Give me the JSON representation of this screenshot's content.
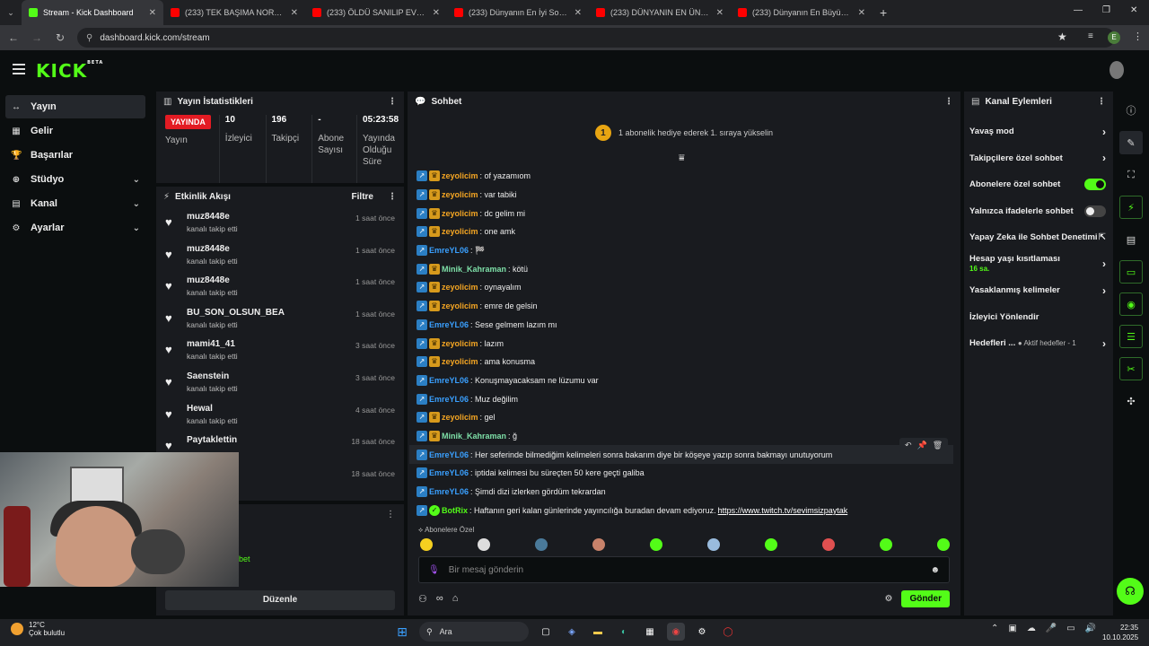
{
  "browser": {
    "tabs": [
      {
        "title": "Stream - Kick Dashboard",
        "fav": "#53fc18",
        "active": true
      },
      {
        "title": "(233) TEK BAŞIMA NORVEÇ KÖ",
        "fav": "#ff0000"
      },
      {
        "title": "(233) ÖLDÜ SANILIP EVEREST'I",
        "fav": "#ff0000"
      },
      {
        "title": "(233) Dünyanın En İyi Sokak Ye",
        "fav": "#ff0000"
      },
      {
        "title": "(233) DÜNYANIN EN ÜNLÜ HA",
        "fav": "#ff0000"
      },
      {
        "title": "(233) Dünyanın En Büyük Mağa",
        "fav": "#ff0000"
      }
    ],
    "url": "dashboard.kick.com/stream",
    "profile_letter": "E"
  },
  "kick": {
    "logo": "KICK",
    "beta": "BETA"
  },
  "sidebar": [
    {
      "icon": "↔",
      "label": "Yayın",
      "active": true
    },
    {
      "icon": "▦",
      "label": "Gelir"
    },
    {
      "icon": "🏆",
      "label": "Başarılar"
    },
    {
      "icon": "⊕",
      "label": "Stüdyo",
      "chev": true
    },
    {
      "icon": "▤",
      "label": "Kanal",
      "chev": true
    },
    {
      "icon": "⚙",
      "label": "Ayarlar",
      "chev": true
    }
  ],
  "stats": {
    "title": "Yayın İstatistikleri",
    "live": "YAYINDA",
    "live_label": "Yayın",
    "items": [
      {
        "value": "10",
        "label": "İzleyici"
      },
      {
        "value": "196",
        "label": "Takipçi"
      },
      {
        "value": "-",
        "label": "Abone Sayısı"
      },
      {
        "value": "05:23:58",
        "label": "Yayında Olduğu Süre"
      }
    ]
  },
  "activity": {
    "title": "Etkinlik Akışı",
    "filter": "Filtre",
    "items": [
      {
        "user": "muz8448e",
        "sub": "kanalı takip etti",
        "time": "1 saat önce"
      },
      {
        "user": "muz8448e",
        "sub": "kanalı takip etti",
        "time": "1 saat önce"
      },
      {
        "user": "muz8448e",
        "sub": "kanalı takip etti",
        "time": "1 saat önce"
      },
      {
        "user": "BU_SON_OLSUN_BEA",
        "sub": "kanalı takip etti",
        "time": "1 saat önce"
      },
      {
        "user": "mami41_41",
        "sub": "kanalı takip etti",
        "time": "3 saat önce"
      },
      {
        "user": "Saenstein",
        "sub": "kanalı takip etti",
        "time": "3 saat önce"
      },
      {
        "user": "Hewal",
        "sub": "kanalı takip etti",
        "time": "4 saat önce"
      },
      {
        "user": "Paytaklettin",
        "sub": "",
        "time": "18 saat önce"
      },
      {
        "user": "",
        "sub": "",
        "time": "18 saat önce"
      }
    ]
  },
  "bottom_left": {
    "edit": "Düzenle",
    "partial": "bet"
  },
  "chat": {
    "title": "Sohbet",
    "gift_rank": "1",
    "gift_text": "1 abonelik hediye ederek 1. sıraya yükselin",
    "messages": [
      {
        "badges": [
          "b1",
          "b2"
        ],
        "user": "zeyolicim",
        "color": "#f5a623",
        "text": ": of yazamıom"
      },
      {
        "badges": [
          "b1",
          "b2"
        ],
        "user": "zeyolicim",
        "color": "#f5a623",
        "text": ": var tabiki"
      },
      {
        "badges": [
          "b1",
          "b2"
        ],
        "user": "zeyolicim",
        "color": "#f5a623",
        "text": ": dc gelim mi"
      },
      {
        "badges": [
          "b1",
          "b2"
        ],
        "user": "zeyolicim",
        "color": "#f5a623",
        "text": ": one amk"
      },
      {
        "badges": [
          "b1"
        ],
        "user": "EmreYL06",
        "color": "#3aa0ff",
        "text": ": 🏁"
      },
      {
        "badges": [
          "b1",
          "b2"
        ],
        "user": "Minik_Kahraman",
        "color": "#7ee0a8",
        "text": ": kötü"
      },
      {
        "badges": [
          "b1",
          "b2"
        ],
        "user": "zeyolicim",
        "color": "#f5a623",
        "text": ": oynayalım"
      },
      {
        "badges": [
          "b1",
          "b2"
        ],
        "user": "zeyolicim",
        "color": "#f5a623",
        "text": ": emre de gelsin"
      },
      {
        "badges": [
          "b1"
        ],
        "user": "EmreYL06",
        "color": "#3aa0ff",
        "text": ": Sese gelmem lazım mı"
      },
      {
        "badges": [
          "b1",
          "b2"
        ],
        "user": "zeyolicim",
        "color": "#f5a623",
        "text": ": lazım"
      },
      {
        "badges": [
          "b1",
          "b2"
        ],
        "user": "zeyolicim",
        "color": "#f5a623",
        "text": ": ama konusma"
      },
      {
        "badges": [
          "b1"
        ],
        "user": "EmreYL06",
        "color": "#3aa0ff",
        "text": ": Konuşmayacaksam ne lüzumu var"
      },
      {
        "badges": [
          "b1"
        ],
        "user": "EmreYL06",
        "color": "#3aa0ff",
        "text": ": Muz değilim"
      },
      {
        "badges": [
          "b1",
          "b2"
        ],
        "user": "zeyolicim",
        "color": "#f5a623",
        "text": ": gel"
      },
      {
        "badges": [
          "b1",
          "b2"
        ],
        "user": "Minik_Kahraman",
        "color": "#7ee0a8",
        "text": ": ğ"
      },
      {
        "badges": [
          "b1"
        ],
        "user": "EmreYL06",
        "color": "#3aa0ff",
        "text": ": Her seferinde bilmediğim kelimeleri sonra bakarım diye bir köşeye yazıp sonra bakmayı unutuyorum"
      },
      {
        "badges": [
          "b1"
        ],
        "user": "EmreYL06",
        "color": "#3aa0ff",
        "text": ": iptidai kelimesi bu süreçten 50 kere geçti galiba"
      },
      {
        "badges": [
          "b1"
        ],
        "user": "EmreYL06",
        "color": "#3aa0ff",
        "text": ": Şimdi dizi izlerken gördüm tekrardan"
      },
      {
        "badges": [
          "b1",
          "b3"
        ],
        "user": "BotRix",
        "color": "#53fc18",
        "text": ": Haftanın geri kalan günlerinde yayıncılığa buradan devam ediyoruz. ",
        "link": "https://www.twitch.tv/sevimsizpaytak"
      }
    ],
    "subs_only": "Abonelere Özel",
    "emote_colors": [
      "#f5d020",
      "#ddd",
      "#4a7a9a",
      "#c8826a",
      "#53fc18",
      "#9bd",
      "#53fc18",
      "#e05050",
      "#53fc18",
      "#53fc18"
    ],
    "input_placeholder": "Bir mesaj gönderin",
    "send": "Gönder"
  },
  "actions": {
    "title": "Kanal Eylemleri",
    "items": [
      {
        "label": "Yavaş mod",
        "type": "chev"
      },
      {
        "label": "Takipçilere özel sohbet",
        "type": "chev"
      },
      {
        "label": "Abonelere özel sohbet",
        "type": "toggle-on"
      },
      {
        "label": "Yalnızca ifadelerle sohbet",
        "type": "toggle-off"
      },
      {
        "label": "Yapay Zeka ile Sohbet Denetimi",
        "type": "ext"
      },
      {
        "label": "Hesap yaşı kısıtlaması",
        "sub": "16 sa.",
        "type": "chev"
      },
      {
        "label": "Yasaklanmış kelimeler",
        "type": "chev"
      },
      {
        "label": "İzleyici Yönlendir",
        "type": "none"
      },
      {
        "label": "Hedefleri ...",
        "sub_inline": "● Aktif hedefler - 1",
        "type": "chev"
      }
    ]
  },
  "taskbar": {
    "temp": "12°C",
    "weather": "Çok bulutlu",
    "search": "Ara",
    "time": "22:35",
    "date": "10.10.2025"
  }
}
